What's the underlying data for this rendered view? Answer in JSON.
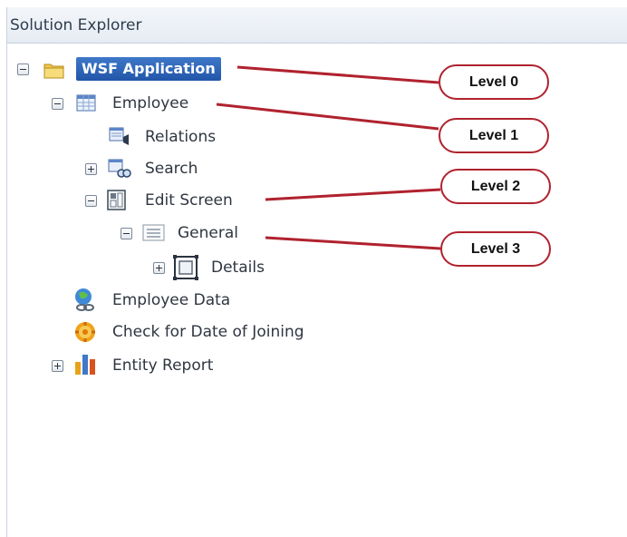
{
  "panel": {
    "title": "Solution Explorer"
  },
  "tree": {
    "root": "WSF Application",
    "employee": "Employee",
    "relations": "Relations",
    "search": "Search",
    "edit_screen": "Edit Screen",
    "general": "General",
    "details": "Details",
    "employee_data": "Employee Data",
    "check_doj": "Check for Date of Joining",
    "entity_report": "Entity Report"
  },
  "callouts": [
    "Level 0",
    "Level 1",
    "Level 2",
    "Level 3"
  ],
  "colors": {
    "selection": "#2a5fb0",
    "callout_border": "#b0222e",
    "leader_line": "#b0222e"
  }
}
